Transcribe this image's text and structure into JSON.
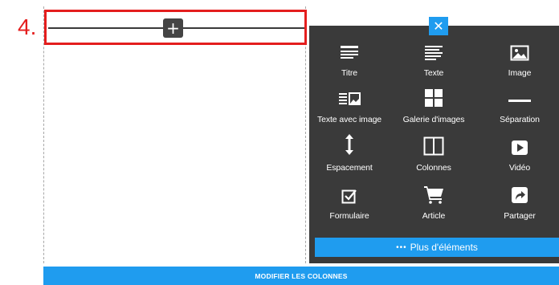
{
  "step": {
    "number": "4."
  },
  "add_button": {
    "symbol": "+"
  },
  "panel": {
    "close_symbol": "✕",
    "tools": [
      {
        "label": "Titre",
        "icon": "title-icon"
      },
      {
        "label": "Texte",
        "icon": "text-icon"
      },
      {
        "label": "Image",
        "icon": "image-icon"
      },
      {
        "label": "Texte avec image",
        "icon": "text-with-image-icon"
      },
      {
        "label": "Galerie d'images",
        "icon": "gallery-icon"
      },
      {
        "label": "Séparation",
        "icon": "separator-icon"
      },
      {
        "label": "Espacement",
        "icon": "spacing-icon"
      },
      {
        "label": "Colonnes",
        "icon": "columns-icon"
      },
      {
        "label": "Vidéo",
        "icon": "video-icon"
      },
      {
        "label": "Formulaire",
        "icon": "form-icon"
      },
      {
        "label": "Article",
        "icon": "cart-icon"
      },
      {
        "label": "Partager",
        "icon": "share-icon"
      }
    ],
    "more_dots": "•••",
    "more_label": "Plus d'éléments"
  },
  "bottom_bar": {
    "label": "MODIFIER LES COLONNES"
  },
  "colors": {
    "accent": "#1f9cef",
    "panel_bg": "#3a3a3a",
    "highlight": "#e41e1e"
  }
}
